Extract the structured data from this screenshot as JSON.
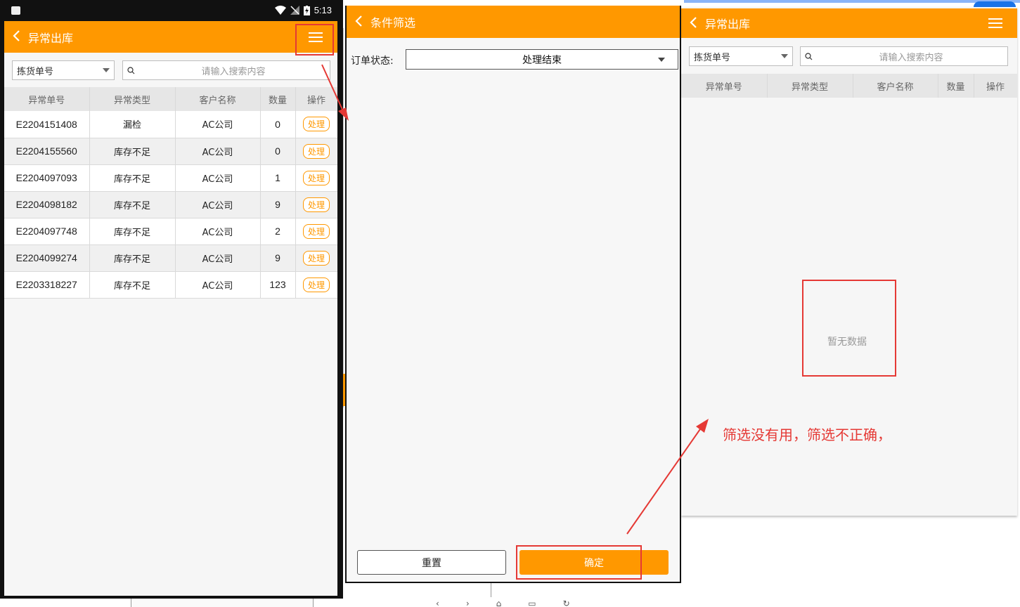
{
  "screen1": {
    "status_time": "5:13",
    "title": "异常出库",
    "picking_select": "拣货单号",
    "search_placeholder": "请输入搜索内容",
    "columns": [
      "异常单号",
      "异常类型",
      "客户名称",
      "数量",
      "操作"
    ],
    "rows": [
      {
        "code": "E2204151408",
        "type": "漏检",
        "customer": "AC公司",
        "qty": "0",
        "action": "处理"
      },
      {
        "code": "E2204155560",
        "type": "库存不足",
        "customer": "AC公司",
        "qty": "0",
        "action": "处理"
      },
      {
        "code": "E2204097093",
        "type": "库存不足",
        "customer": "AC公司",
        "qty": "1",
        "action": "处理"
      },
      {
        "code": "E2204098182",
        "type": "库存不足",
        "customer": "AC公司",
        "qty": "9",
        "action": "处理"
      },
      {
        "code": "E2204097748",
        "type": "库存不足",
        "customer": "AC公司",
        "qty": "2",
        "action": "处理"
      },
      {
        "code": "E2204099274",
        "type": "库存不足",
        "customer": "AC公司",
        "qty": "9",
        "action": "处理"
      },
      {
        "code": "E2203318227",
        "type": "库存不足",
        "customer": "AC公司",
        "qty": "123",
        "action": "处理"
      }
    ]
  },
  "screen2": {
    "title": "条件筛选",
    "order_status_label": "订单状态:",
    "order_status_value": "处理结束",
    "reset_label": "重置",
    "confirm_label": "确定"
  },
  "screen3": {
    "title": "异常出库",
    "picking_select": "拣货单号",
    "search_placeholder": "请输入搜索内容",
    "columns": [
      "异常单号",
      "异常类型",
      "客户名称",
      "数量",
      "操作"
    ],
    "empty_text": "暂无数据"
  },
  "annotation": {
    "comment": "筛选没有用，筛选不正确，"
  },
  "colors": {
    "accent": "#ff9800",
    "annotation": "#e53935"
  }
}
